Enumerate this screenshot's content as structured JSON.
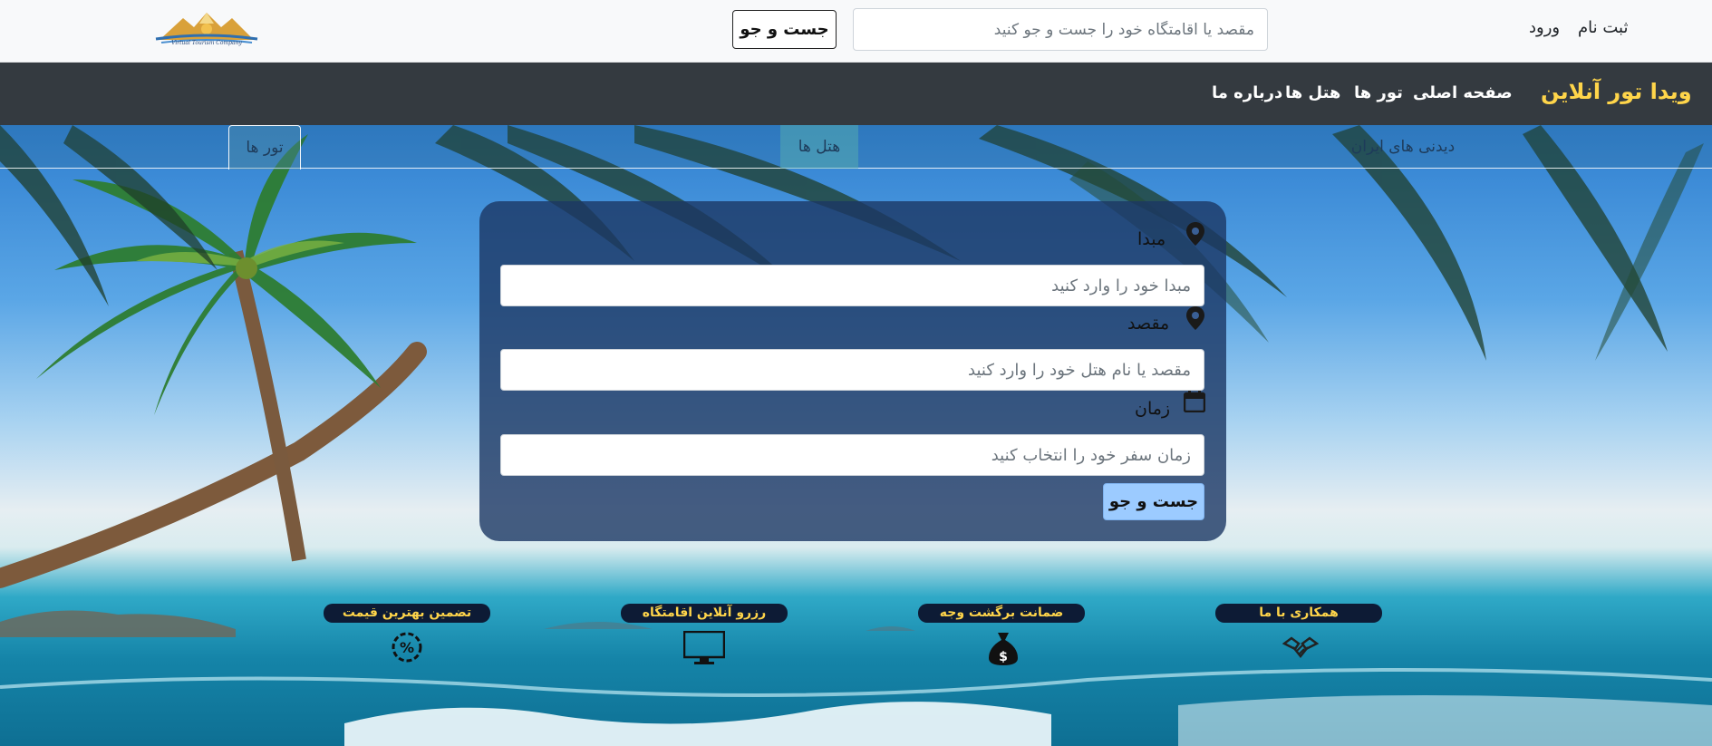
{
  "header": {
    "logo_text": "Virtual Tourism Company",
    "search_placeholder": "مقصد یا اقامتگاه خود را جست و جو کنید",
    "search_button": "جست و جو",
    "login": "ورود",
    "signup": "ثبت نام"
  },
  "navbar": {
    "brand": "ویدا تور آنلاین",
    "items": [
      {
        "label": "صفحه اصلی"
      },
      {
        "label": "تور ها"
      },
      {
        "label": "هتل ها"
      },
      {
        "label": "درباره ما"
      }
    ]
  },
  "tabs": [
    {
      "label": "تور ها",
      "active": true
    },
    {
      "label": "هتل ها",
      "active": false
    },
    {
      "label": "دیدنی های ایران",
      "active": false
    }
  ],
  "search_form": {
    "origin": {
      "label": "مبدا",
      "placeholder": "مبدا خود را وارد کنید",
      "icon": "map-marker-icon"
    },
    "destination": {
      "label": "مقصد",
      "placeholder": "مقصد یا نام هتل خود را وارد کنید",
      "icon": "map-marker-icon"
    },
    "date": {
      "label": "زمان",
      "placeholder": "زمان سفر خود را انتخاب کنید",
      "icon": "calendar-icon"
    },
    "submit": "جست و جو"
  },
  "features": [
    {
      "title": "تضمین بهترین قیمت",
      "icon": "percent-badge-icon"
    },
    {
      "title": "رزرو آنلاین اقامتگاه",
      "icon": "monitor-icon"
    },
    {
      "title": "ضمانت برگشت وجه",
      "icon": "money-bag-icon"
    },
    {
      "title": "همکاری با ما",
      "icon": "handshake-icon"
    }
  ],
  "colors": {
    "navbar_bg": "#343a40",
    "brand": "#ffd54a",
    "feature_badge_bg": "#0d1b35",
    "submit_button": "#9ccbff"
  }
}
